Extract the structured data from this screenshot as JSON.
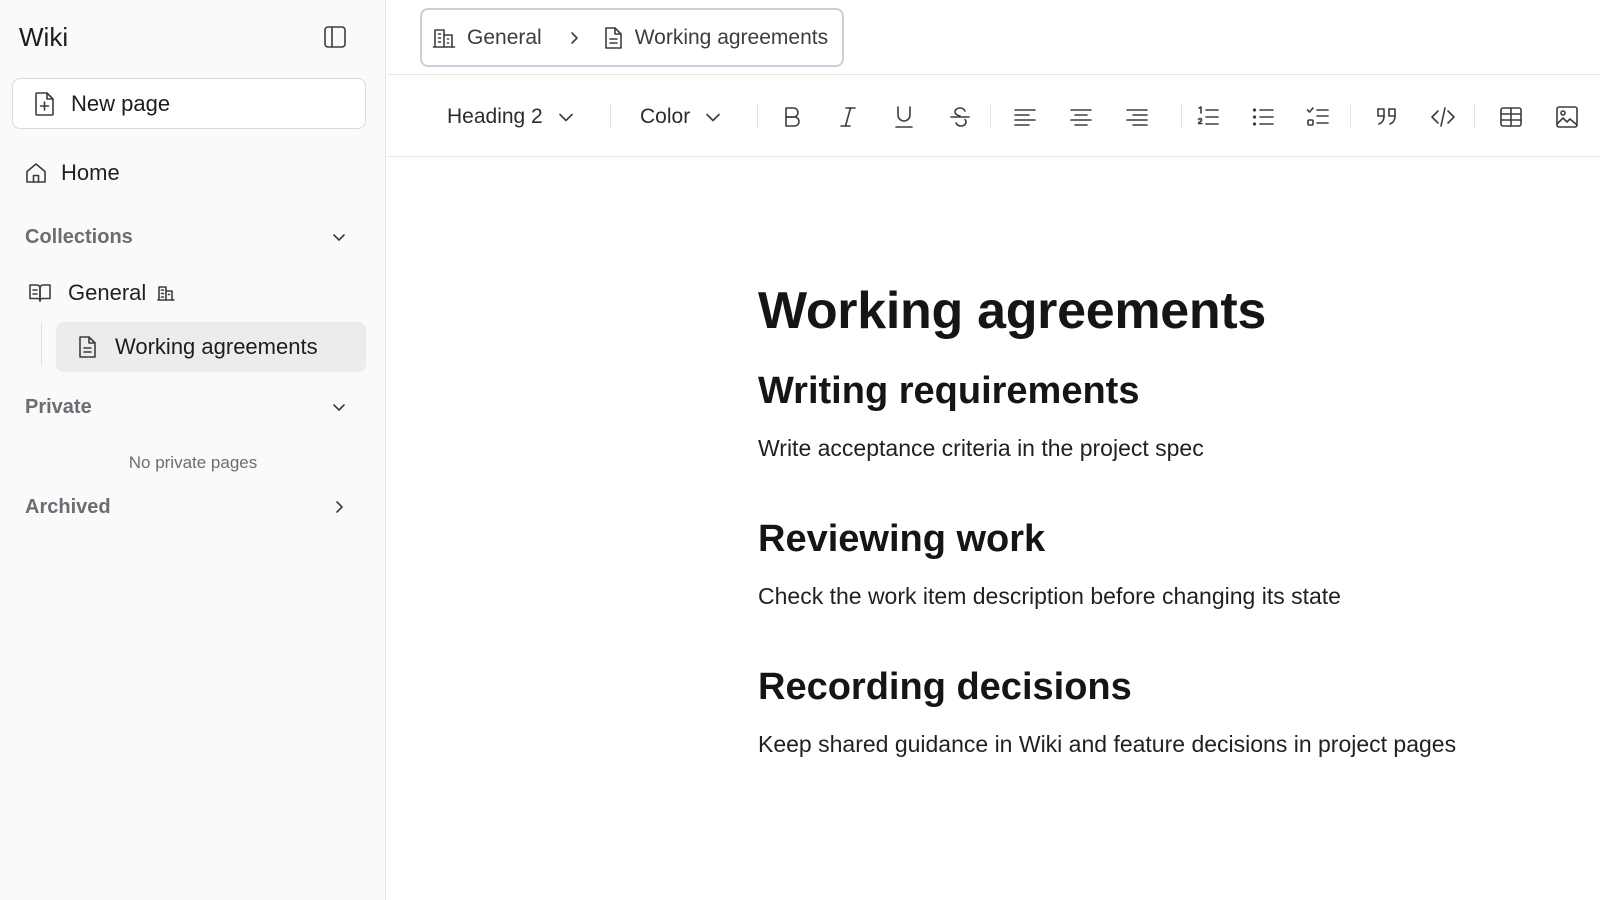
{
  "sidebar": {
    "title": "Wiki",
    "new_page_label": "New page",
    "home_label": "Home",
    "collections_label": "Collections",
    "collection_name": "General",
    "active_page": "Working agreements",
    "private_label": "Private",
    "private_empty": "No private pages",
    "archived_label": "Archived"
  },
  "breadcrumb": {
    "items": [
      "General",
      "Working agreements"
    ]
  },
  "toolbar": {
    "heading_select": "Heading 2",
    "color_select": "Color",
    "buttons": [
      "bold-icon",
      "italic-icon",
      "underline-icon",
      "strikethrough-icon",
      "align-left-icon",
      "align-center-icon",
      "align-right-icon",
      "ordered-list-icon",
      "bullet-list-icon",
      "task-list-icon",
      "quote-icon",
      "code-icon",
      "table-icon",
      "image-icon"
    ]
  },
  "document": {
    "title": "Working agreements",
    "sections": [
      {
        "heading": "Writing requirements",
        "body": "Write acceptance criteria in the project spec"
      },
      {
        "heading": "Reviewing work",
        "body": "Check the work item description before changing its state"
      },
      {
        "heading": "Recording decisions",
        "body": "Keep shared guidance in Wiki and feature decisions in project pages"
      }
    ]
  }
}
